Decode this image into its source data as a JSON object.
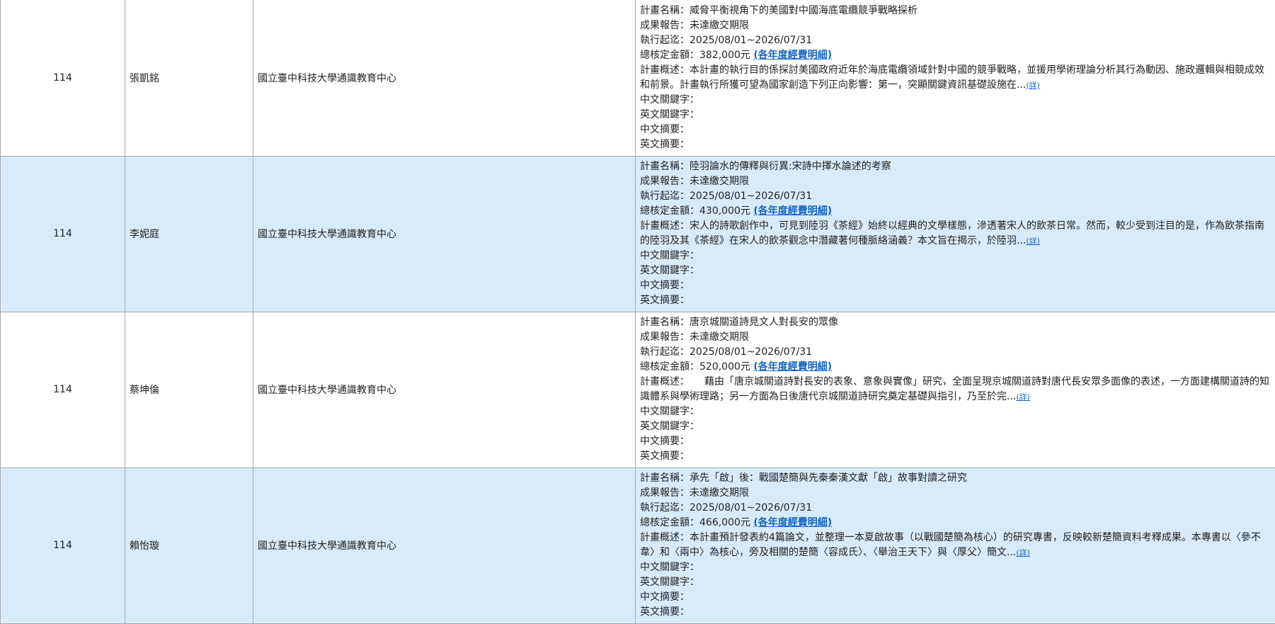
{
  "labels": {
    "project_name": "計畫名稱：",
    "report": "成果報告：",
    "period": "執行起迄：",
    "amount": "總核定金額：",
    "budget_link": "(各年度經費明細)",
    "summary": "計畫概述：",
    "more_link": "(詳)",
    "zh_keywords": "中文關鍵字：",
    "en_keywords": "英文關鍵字：",
    "zh_abstract": "中文摘要：",
    "en_abstract": "英文摘要："
  },
  "rows": [
    {
      "year": "114",
      "investigator": "張凱銘",
      "institution": "國立臺中科技大學通識教育中心",
      "project_name": "威脅平衡視角下的美國對中國海底電纜競爭戰略探析",
      "report": "未達繳交期限",
      "period": "2025/08/01~2026/07/31",
      "amount": "382,000元",
      "summary": "本計畫的執行目的係探討美國政府近年於海底電纜領域針對中國的競爭戰略，並援用學術理論分析其行為動因、施政邏輯與相競成效和前景。計畫執行所獲可望為國家創造下列正向影響：第一，突顯關鍵資訊基礎設施在...",
      "zh_keywords": "",
      "en_keywords": "",
      "zh_abstract": "",
      "en_abstract": ""
    },
    {
      "year": "114",
      "investigator": "李妮庭",
      "institution": "國立臺中科技大學通識教育中心",
      "project_name": "陸羽論水的傳釋與衍異:宋詩中擇水論述的考察",
      "report": "未達繳交期限",
      "period": "2025/08/01~2026/07/31",
      "amount": "430,000元",
      "summary": "宋人的詩歌創作中，可見到陸羽《茶經》始終以經典的文學樣態，滲透著宋人的飲茶日常。然而，較少受到注目的是，作為飲茶指南的陸羽及其《茶經》在宋人的飲茶觀念中潛藏著何種脈絡涵義？本文旨在揭示，於陸羽...",
      "zh_keywords": "",
      "en_keywords": "",
      "zh_abstract": "",
      "en_abstract": ""
    },
    {
      "year": "114",
      "investigator": "蔡坤倫",
      "institution": "國立臺中科技大學通識教育中心",
      "project_name": "唐京城關道詩見文人對長安的眾像",
      "report": "未達繳交期限",
      "period": "2025/08/01~2026/07/31",
      "amount": "520,000元",
      "summary": "　　藉由「唐京城關道詩對長安的表象、意象與實像」研究，全面呈現京城關道詩對唐代長安眾多面像的表述，一方面建構關道詩的知識體系與學術理路；另一方面為日後唐代京城關道詩研究奠定基礎與指引，乃至於完...",
      "zh_keywords": "",
      "en_keywords": "",
      "zh_abstract": "",
      "en_abstract": ""
    },
    {
      "year": "114",
      "investigator": "賴怡璇",
      "institution": "國立臺中科技大學通識教育中心",
      "project_name": "承先「啟」後：戰國楚簡與先秦秦漢文獻「啟」故事對讀之研究",
      "report": "未達繳交期限",
      "period": "2025/08/01~2026/07/31",
      "amount": "466,000元",
      "summary": "本計畫預計發表約4篇論文，並整理一本夏啟故事（以戰國楚簡為核心）的研究專書，反映較新楚簡資料考釋成果。本專書以〈參不韋〉和〈兩中〉為核心，旁及相關的楚簡〈容成氏〉、〈舉治王天下〉與〈厚父〉簡文...",
      "zh_keywords": "",
      "en_keywords": "",
      "zh_abstract": "",
      "en_abstract": ""
    }
  ]
}
